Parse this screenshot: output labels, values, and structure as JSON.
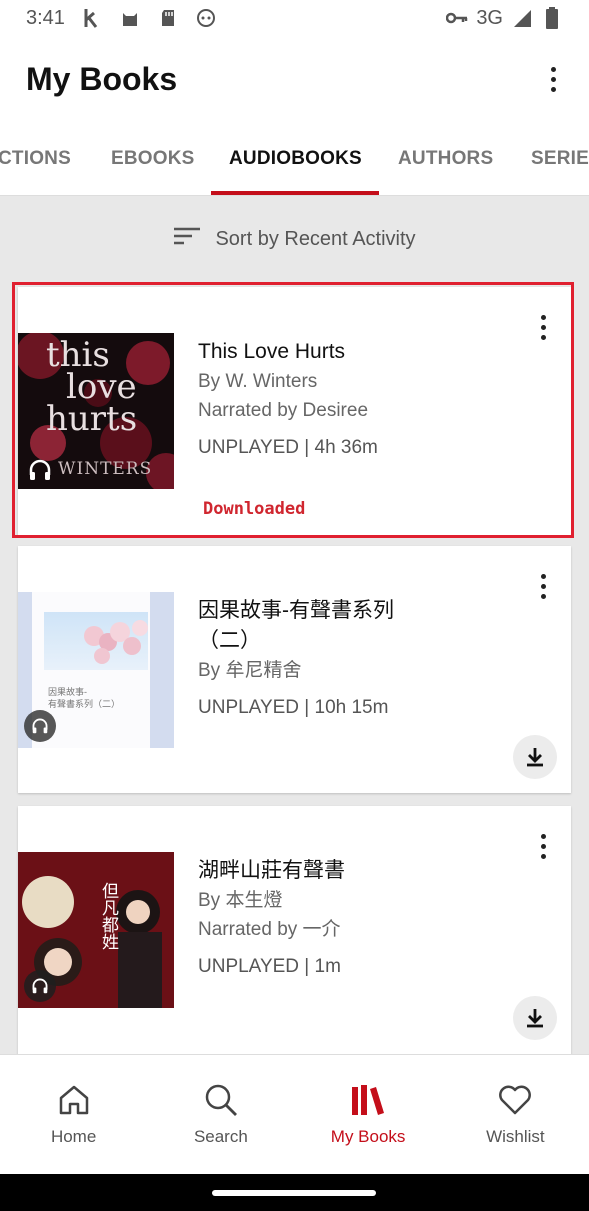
{
  "status_bar": {
    "time": "3:41",
    "network": "3G"
  },
  "app_bar": {
    "title": "My Books"
  },
  "tabs": [
    {
      "label": "CTIONS"
    },
    {
      "label": "EBOOKS"
    },
    {
      "label": "AUDIOBOOKS",
      "active": true
    },
    {
      "label": "AUTHORS"
    },
    {
      "label": "SERIE"
    }
  ],
  "sort": {
    "label": "Sort by Recent Activity"
  },
  "books": [
    {
      "title": "This Love Hurts",
      "author": "By W. Winters",
      "narrator": "Narrated by Desiree",
      "status": "UNPLAYED | 4h 36m",
      "download_label": "Downloaded",
      "cover_text": [
        "this",
        "love",
        "hurts"
      ],
      "cover_author": "WINTERS"
    },
    {
      "title": "因果故事-有聲書系列（二）",
      "author": "By 牟尼精舍",
      "status": "UNPLAYED | 10h 15m",
      "cover_caption": "因果故事-\n有聲書系列（二）"
    },
    {
      "title": "湖畔山莊有聲書",
      "author": "By 本生燈",
      "narrator": "Narrated by 一介",
      "status": "UNPLAYED | 1m",
      "cover_text": "但凡都姓"
    }
  ],
  "bottom_nav": [
    {
      "label": "Home",
      "icon": "home-icon"
    },
    {
      "label": "Search",
      "icon": "search-icon"
    },
    {
      "label": "My Books",
      "icon": "library-icon",
      "active": true
    },
    {
      "label": "Wishlist",
      "icon": "heart-icon"
    }
  ],
  "colors": {
    "accent": "#c40e1a",
    "download_badge": "#d0262f",
    "highlight": "#e02030"
  }
}
